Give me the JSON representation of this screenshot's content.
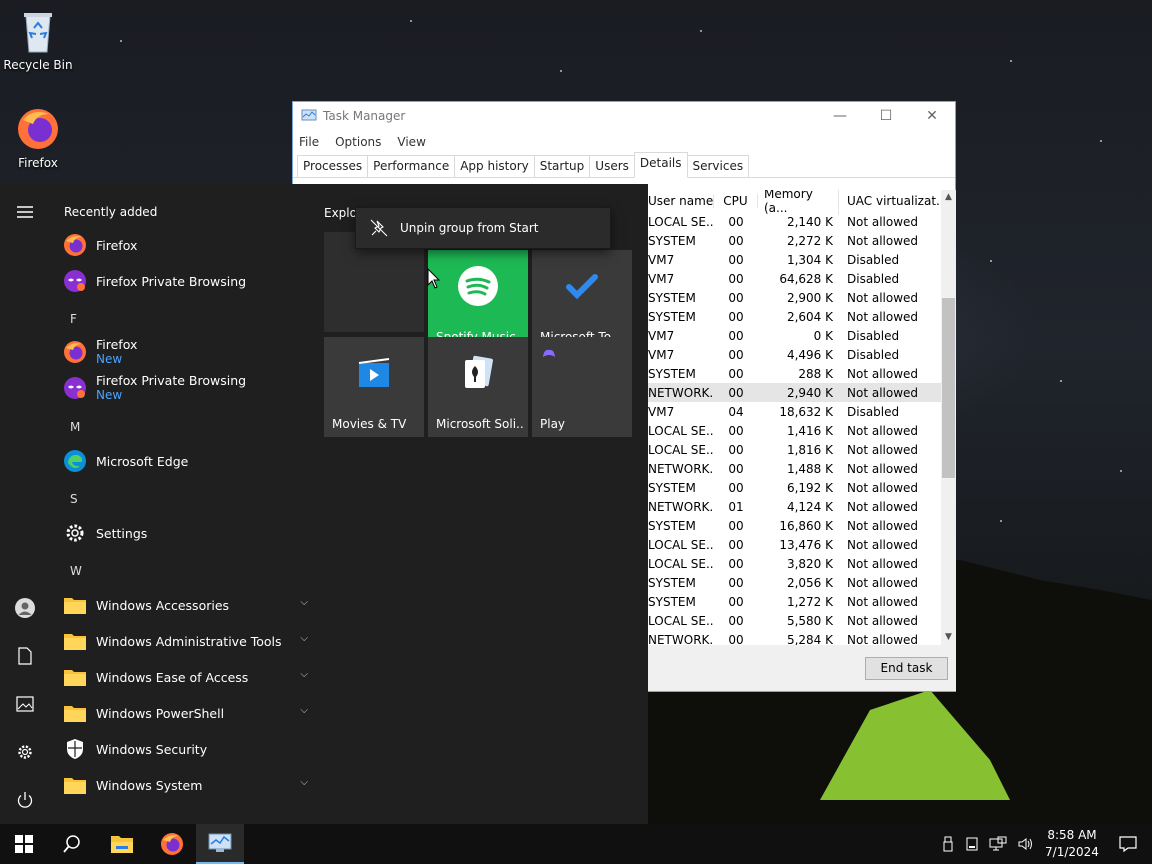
{
  "desktop": {
    "icons": [
      {
        "label": "Recycle Bin",
        "icon": "recycle-bin-icon"
      },
      {
        "label": "Firefox",
        "icon": "firefox-icon"
      }
    ]
  },
  "task_manager": {
    "title": "Task Manager",
    "menu": [
      "File",
      "Options",
      "View"
    ],
    "tabs": [
      "Processes",
      "Performance",
      "App history",
      "Startup",
      "Users",
      "Details",
      "Services"
    ],
    "active_tab": "Details",
    "columns": [
      "User name",
      "CPU",
      "Memory (a...",
      "UAC virtualizat..."
    ],
    "rows": [
      [
        "LOCAL SE...",
        "00",
        "2,140 K",
        "Not allowed"
      ],
      [
        "SYSTEM",
        "00",
        "2,272 K",
        "Not allowed"
      ],
      [
        "VM7",
        "00",
        "1,304 K",
        "Disabled"
      ],
      [
        "VM7",
        "00",
        "64,628 K",
        "Disabled"
      ],
      [
        "SYSTEM",
        "00",
        "2,900 K",
        "Not allowed"
      ],
      [
        "SYSTEM",
        "00",
        "2,604 K",
        "Not allowed"
      ],
      [
        "VM7",
        "00",
        "0 K",
        "Disabled"
      ],
      [
        "VM7",
        "00",
        "4,496 K",
        "Disabled"
      ],
      [
        "SYSTEM",
        "00",
        "288 K",
        "Not allowed"
      ],
      [
        "NETWORK...",
        "00",
        "2,940 K",
        "Not allowed"
      ],
      [
        "VM7",
        "04",
        "18,632 K",
        "Disabled"
      ],
      [
        "LOCAL SE...",
        "00",
        "1,416 K",
        "Not allowed"
      ],
      [
        "LOCAL SE...",
        "00",
        "1,816 K",
        "Not allowed"
      ],
      [
        "NETWORK...",
        "00",
        "1,488 K",
        "Not allowed"
      ],
      [
        "SYSTEM",
        "00",
        "6,192 K",
        "Not allowed"
      ],
      [
        "NETWORK...",
        "01",
        "4,124 K",
        "Not allowed"
      ],
      [
        "SYSTEM",
        "00",
        "16,860 K",
        "Not allowed"
      ],
      [
        "LOCAL SE...",
        "00",
        "13,476 K",
        "Not allowed"
      ],
      [
        "LOCAL SE...",
        "00",
        "3,820 K",
        "Not allowed"
      ],
      [
        "SYSTEM",
        "00",
        "2,056 K",
        "Not allowed"
      ],
      [
        "SYSTEM",
        "00",
        "1,272 K",
        "Not allowed"
      ],
      [
        "LOCAL SE...",
        "00",
        "5,580 K",
        "Not allowed"
      ],
      [
        "NETWORK...",
        "00",
        "5,284 K",
        "Not allowed"
      ]
    ],
    "selected_row": 9,
    "end_task_label": "End task"
  },
  "start_menu": {
    "recently_added_label": "Recently added",
    "recently_added": [
      {
        "label": "Firefox",
        "icon": "firefox-icon"
      },
      {
        "label": "Firefox Private Browsing",
        "icon": "firefox-private-icon"
      }
    ],
    "letters": {
      "f": "F",
      "m": "M",
      "s": "S",
      "w": "W"
    },
    "new_badge": "New",
    "apps": {
      "firefox": "Firefox",
      "firefox_private": "Firefox Private Browsing",
      "edge": "Microsoft Edge",
      "settings": "Settings",
      "win_accessories": "Windows Accessories",
      "win_admin_tools": "Windows Administrative Tools",
      "win_ease": "Windows Ease of Access",
      "win_powershell": "Windows PowerShell",
      "win_security": "Windows Security",
      "win_system": "Windows System"
    },
    "tiles_group_label": "Explor",
    "tiles": {
      "spotify": "Spotify Music",
      "todo": "Microsoft To...",
      "movies": "Movies & TV",
      "solitaire": "Microsoft Soli...",
      "play": "Play"
    },
    "context_menu": {
      "label": "Unpin group from Start",
      "icon": "unpin-icon"
    }
  },
  "taskbar": {
    "time": "8:58 AM",
    "date": "7/1/2024"
  },
  "colors": {
    "spotify_tile": "#1db954",
    "start_bg": "#1f1f1f",
    "taskbar_bg": "#101010",
    "link_blue": "#4aa3ff"
  }
}
